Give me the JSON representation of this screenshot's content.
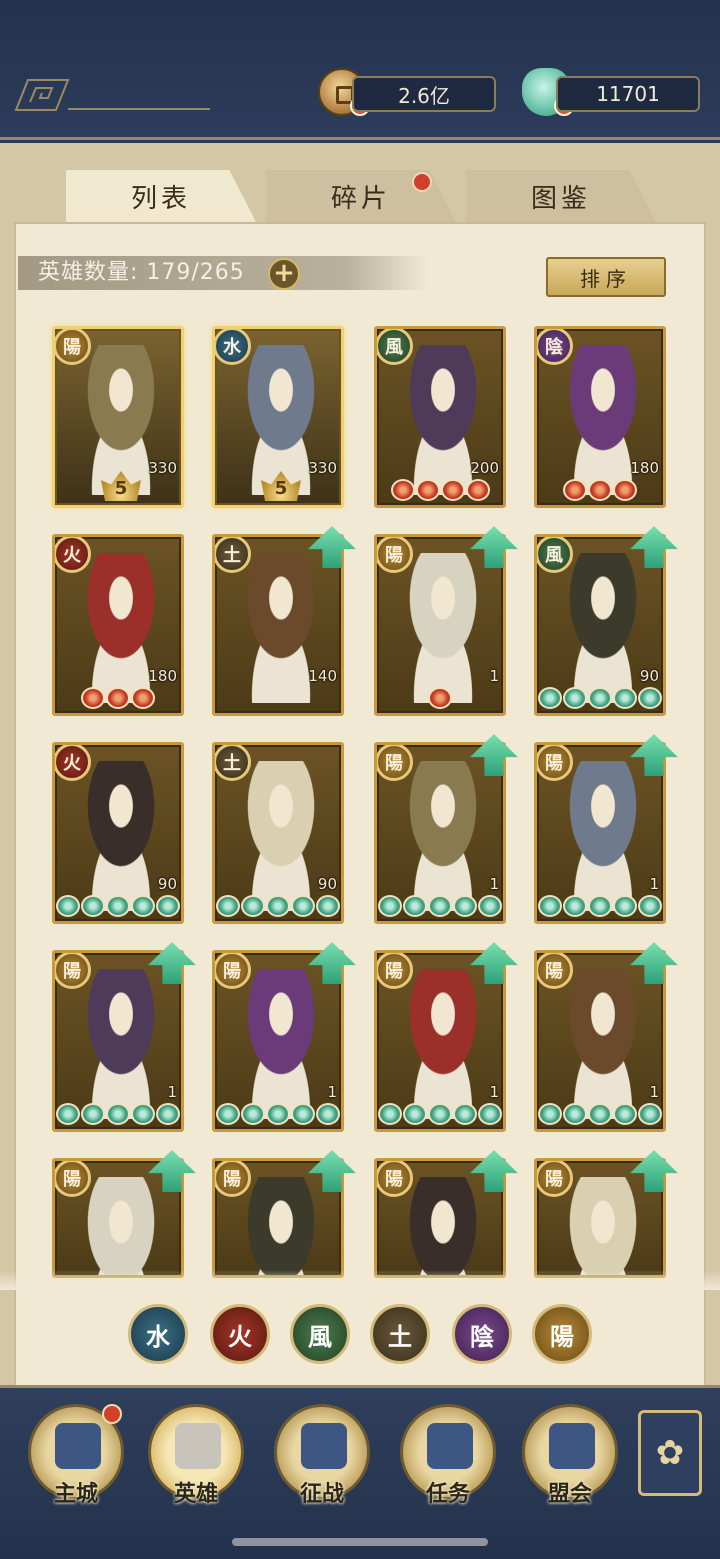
{
  "resources": {
    "coins": "2.6亿",
    "gems": "11701",
    "coin_icon": "copper-coin-icon",
    "gem_icon": "jade-shell-icon"
  },
  "tabs": [
    {
      "label": "列表",
      "active": true
    },
    {
      "label": "碎片",
      "active": false,
      "badge": true
    },
    {
      "label": "图鉴",
      "active": false
    }
  ],
  "hero_count": "英雄数量: 179/265",
  "sort_label": "排序",
  "heroes": [
    {
      "element": "陽",
      "level": "330",
      "rank": "5",
      "stars": 0,
      "upgrade": false
    },
    {
      "element": "水",
      "level": "330",
      "rank": "5",
      "stars": 0,
      "upgrade": false
    },
    {
      "element": "風",
      "level": "200",
      "stars": 4,
      "star_color": "red",
      "upgrade": false
    },
    {
      "element": "陰",
      "level": "180",
      "stars": 3,
      "star_color": "red",
      "upgrade": false
    },
    {
      "element": "火",
      "level": "180",
      "stars": 3,
      "star_color": "red",
      "upgrade": false
    },
    {
      "element": "土",
      "level": "140",
      "stars": 0,
      "upgrade": true
    },
    {
      "element": "陽",
      "level": "1",
      "stars": 1,
      "star_color": "red",
      "upgrade": true
    },
    {
      "element": "風",
      "level": "90",
      "stars": 5,
      "star_color": "green",
      "upgrade": true
    },
    {
      "element": "火",
      "level": "90",
      "stars": 5,
      "star_color": "green",
      "upgrade": false
    },
    {
      "element": "土",
      "level": "90",
      "stars": 5,
      "star_color": "green",
      "upgrade": false
    },
    {
      "element": "陽",
      "level": "1",
      "stars": 5,
      "star_color": "green",
      "upgrade": true
    },
    {
      "element": "陽",
      "level": "1",
      "stars": 5,
      "star_color": "green",
      "upgrade": true
    },
    {
      "element": "陽",
      "level": "1",
      "stars": 5,
      "star_color": "green",
      "upgrade": true
    },
    {
      "element": "陽",
      "level": "1",
      "stars": 5,
      "star_color": "green",
      "upgrade": true
    },
    {
      "element": "陽",
      "level": "1",
      "stars": 5,
      "star_color": "green",
      "upgrade": true
    },
    {
      "element": "陽",
      "level": "1",
      "stars": 5,
      "star_color": "green",
      "upgrade": true
    },
    {
      "element": "陽",
      "level": "",
      "stars": 0,
      "upgrade": true
    },
    {
      "element": "陽",
      "level": "",
      "stars": 0,
      "upgrade": true
    },
    {
      "element": "陽",
      "level": "",
      "stars": 0,
      "upgrade": true
    },
    {
      "element": "陽",
      "level": "",
      "stars": 0,
      "upgrade": true
    }
  ],
  "element_filters": [
    "水",
    "火",
    "風",
    "土",
    "陰",
    "陽"
  ],
  "nav": [
    {
      "label": "主城",
      "icon": "city-gate-icon",
      "badge": true
    },
    {
      "label": "英雄",
      "icon": "hero-avatar-icon",
      "active": true
    },
    {
      "label": "征战",
      "icon": "battle-scroll-icon"
    },
    {
      "label": "任务",
      "icon": "task-bell-icon"
    },
    {
      "label": "盟会",
      "icon": "alliance-lantern-icon"
    }
  ],
  "more_icon": "flower-menu-icon"
}
